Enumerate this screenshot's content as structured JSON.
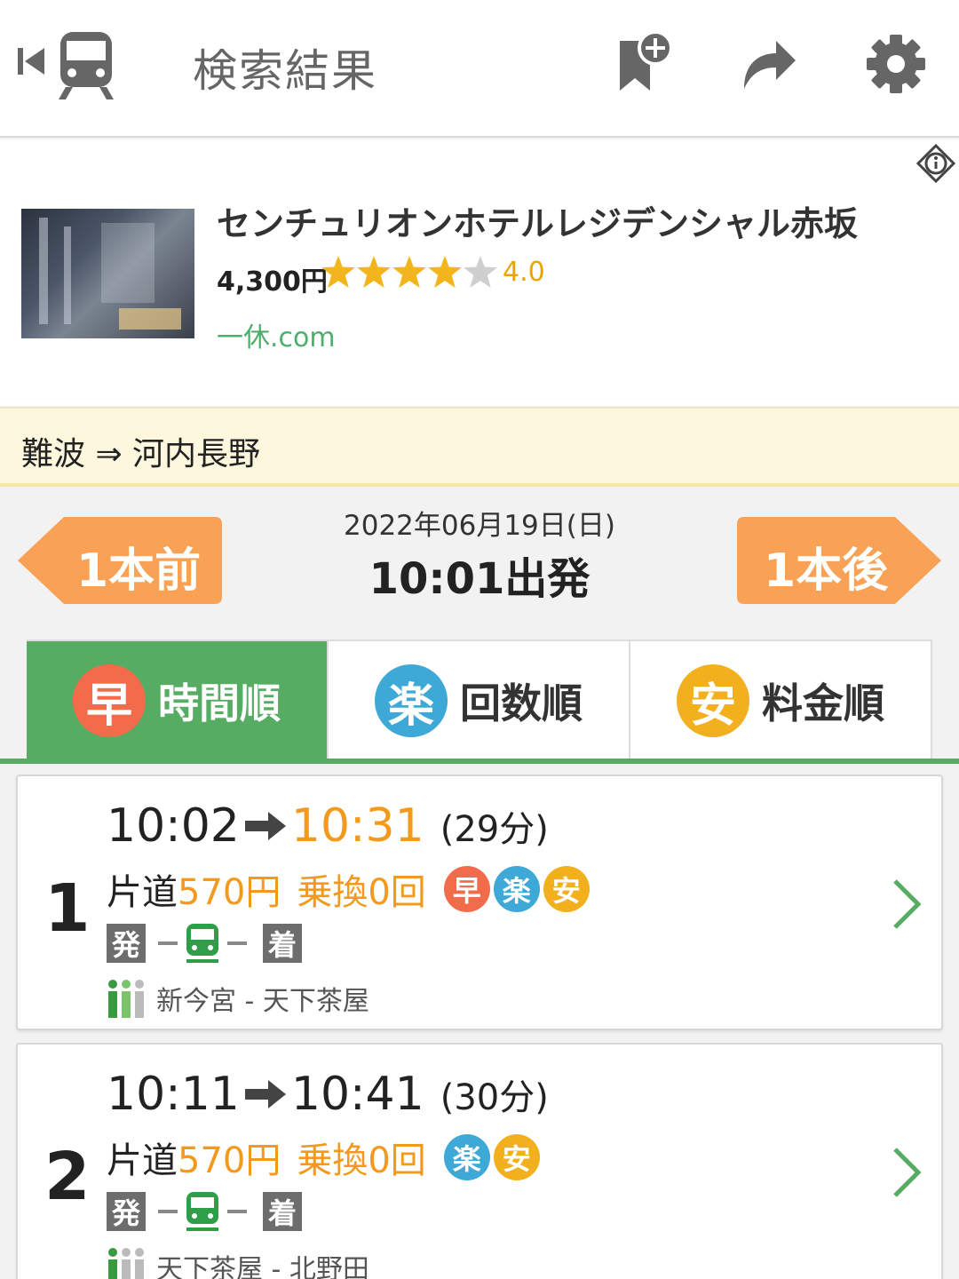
{
  "header": {
    "title": "検索結果",
    "back_icon": "train-back-icon",
    "bookmark_icon": "bookmark-add-icon",
    "share_icon": "share-arrow-icon",
    "settings_icon": "gear-icon"
  },
  "ad": {
    "hotel_name": "センチュリオンホテルレジデンシャル赤坂",
    "price": "4,300円",
    "rating": "4.0",
    "rating_value": 4,
    "rating_max": 5,
    "source": "一休.com",
    "info_icon": "info-icon"
  },
  "route": {
    "label": "難波 ⇒ 河内長野"
  },
  "date_nav": {
    "prev_label": "1本前",
    "next_label": "1本後",
    "date": "2022年06月19日(日)",
    "departure": "10:01出発"
  },
  "tabs": [
    {
      "icon_char": "早",
      "label": "時間順",
      "active": true
    },
    {
      "icon_char": "楽",
      "label": "回数順",
      "active": false
    },
    {
      "icon_char": "安",
      "label": "料金順",
      "active": false
    }
  ],
  "results": [
    {
      "num": "1",
      "depart": "10:02",
      "arrive": "10:31",
      "duration": "(29分)",
      "fare_label": "片道",
      "fare": "570円",
      "transfers": "乗換0回",
      "badges": [
        "早",
        "楽",
        "安"
      ],
      "dep_mark": "発",
      "arr_mark": "着",
      "stations": "新今宮 - 天下茶屋"
    },
    {
      "num": "2",
      "depart": "10:11",
      "arrive": "10:41",
      "duration": "(30分)",
      "fare_label": "片道",
      "fare": "570円",
      "transfers": "乗換0回",
      "badges": [
        "楽",
        "安"
      ],
      "dep_mark": "発",
      "arr_mark": "着",
      "stations": "天下茶屋 - 北野田"
    }
  ],
  "colors": {
    "accent_green": "#56ac63",
    "accent_orange": "#f39a1e",
    "nav_orange": "#f9a255",
    "haya_red": "#f26b4a",
    "raku_blue": "#3ea8d6",
    "yasu_yellow": "#f2b01e"
  }
}
